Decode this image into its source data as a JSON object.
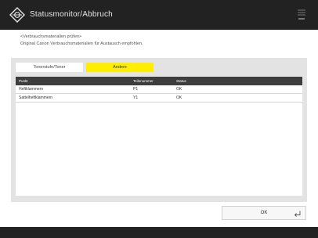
{
  "window": {
    "title": "Statusmonitor/Abbruch",
    "menu_icon": "menu-icon"
  },
  "message": {
    "line1": "<Verbrauchsmaterialien prüfen>",
    "line2": "Original Canon Verbrauchsmaterialien für Austausch empfohlen."
  },
  "tabs": [
    {
      "label": "Tonerstufe/Toner",
      "selected": false
    },
    {
      "label": "Andere",
      "selected": true
    }
  ],
  "table": {
    "headers": [
      "Punkt",
      "Teilenummer",
      "Status"
    ],
    "rows": [
      [
        "Heftklammern",
        "P1",
        "OK"
      ],
      [
        "Sattelheftklammern",
        "Y1",
        "OK"
      ]
    ]
  },
  "ok_button": {
    "label": "OK",
    "icon": "enter-icon"
  },
  "colors": {
    "titlebar": "#222222",
    "selected_tab": "#ffee00",
    "table_header": "#3d3d3d",
    "panel": "#e3e3e3"
  }
}
